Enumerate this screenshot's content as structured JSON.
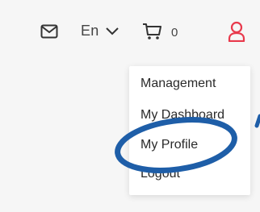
{
  "header": {
    "mail_icon": "mail-icon",
    "language": {
      "label": "En",
      "icon": "chevron-down-icon"
    },
    "cart": {
      "icon": "cart-icon",
      "count": "0"
    },
    "user_icon": "user-icon",
    "accent_color": "#e8394c"
  },
  "dropdown": {
    "items": [
      {
        "label": "Management"
      },
      {
        "label": "My Dashboard"
      },
      {
        "label": "My Profile"
      },
      {
        "label": "Logout"
      }
    ]
  },
  "annotation": {
    "color": "#1e5ea8",
    "shape": "ellipse-highlight"
  }
}
